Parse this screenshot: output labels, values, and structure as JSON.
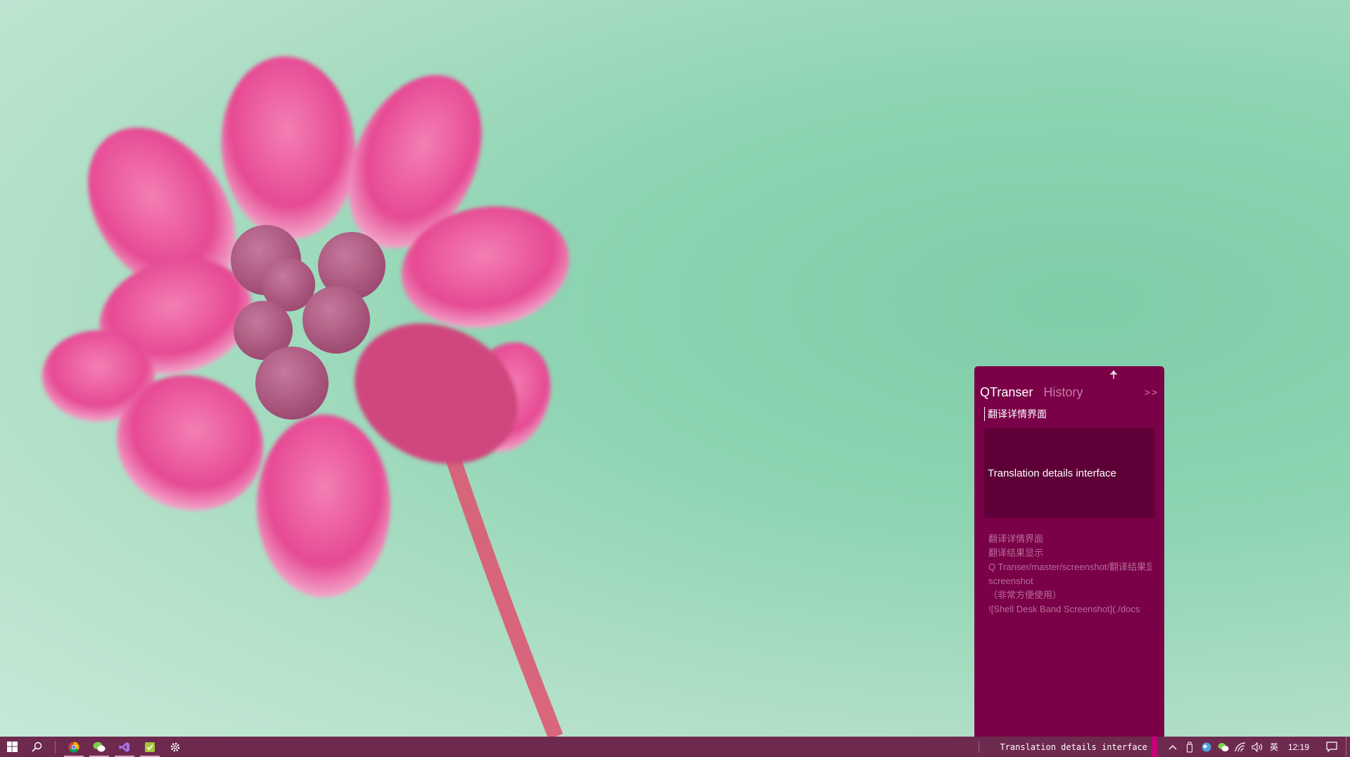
{
  "qtranser": {
    "title": "QTranser",
    "history_tab": "History",
    "collapse": ">>",
    "input_text": "翻译详情界面",
    "result_text": "Translation details interface",
    "details": [
      "翻译详情界面",
      "翻译结果显示",
      "Q Transer/master/screenshot/翻译结果显示",
      "screenshot",
      "（非常方便使用）",
      "![Shell Desk Band Screenshot](./docs"
    ],
    "colors": {
      "panel_bg": "#7a0048",
      "result_bg": "#5e0037",
      "muted_text": "#b86e98"
    }
  },
  "taskbar": {
    "apps": [
      {
        "name": "chrome-icon"
      },
      {
        "name": "wechat-icon"
      },
      {
        "name": "visual-studio-icon"
      },
      {
        "name": "notepad-icon"
      },
      {
        "name": "settings-icon"
      }
    ],
    "deskband_text": "Translation details interface",
    "ime": "英",
    "clock": "12:19",
    "colors": {
      "bg": "#6e2a4e",
      "accent": "#c40079"
    }
  }
}
